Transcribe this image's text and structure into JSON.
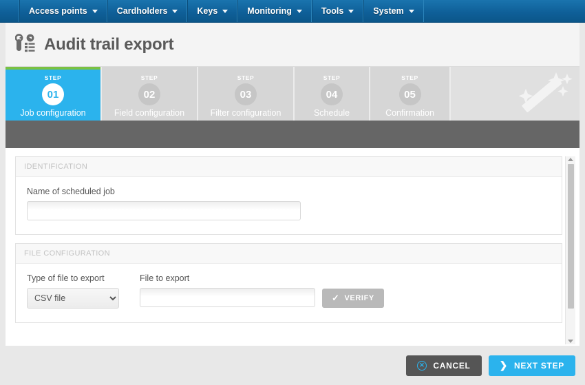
{
  "nav": {
    "items": [
      {
        "label": "Access points",
        "icon": "chevron-down-icon"
      },
      {
        "label": "Cardholders",
        "icon": "chevron-down-icon"
      },
      {
        "label": "Keys",
        "icon": "chevron-down-icon"
      },
      {
        "label": "Monitoring",
        "icon": "chevron-down-icon"
      },
      {
        "label": "Tools",
        "icon": "chevron-down-icon"
      },
      {
        "label": "System",
        "icon": "chevron-down-icon"
      }
    ]
  },
  "header": {
    "title": "Audit trail export",
    "icon": "key-list-export-icon"
  },
  "wizard": {
    "kicker": "STEP",
    "decoration_icon": "magic-wand-icon",
    "steps": [
      {
        "number": "01",
        "label": "Job configuration",
        "active": true
      },
      {
        "number": "02",
        "label": "Field configuration",
        "active": false
      },
      {
        "number": "03",
        "label": "Filter configuration",
        "active": false
      },
      {
        "number": "04",
        "label": "Schedule",
        "active": false
      },
      {
        "number": "05",
        "label": "Confirmation",
        "active": false
      }
    ]
  },
  "identification": {
    "panel_title": "IDENTIFICATION",
    "job_name_label": "Name of scheduled job",
    "job_name_value": "",
    "job_name_placeholder": ""
  },
  "file_configuration": {
    "panel_title": "FILE CONFIGURATION",
    "type_label": "Type of file to export",
    "type_value": "CSV file",
    "type_options": [
      "CSV file"
    ],
    "file_label": "File to export",
    "file_value": "",
    "file_placeholder": "",
    "verify_label": "VERIFY",
    "verify_icon": "check-icon"
  },
  "footer": {
    "cancel_label": "CANCEL",
    "cancel_icon": "circle-x-icon",
    "next_label": "NEXT STEP",
    "next_icon": "chevron-right-icon"
  },
  "scrollbar": {
    "up_icon": "triangle-up-icon",
    "down_icon": "triangle-down-icon"
  },
  "colors": {
    "nav_blue": "#0f6099",
    "accent_blue": "#2bb3ed",
    "accent_green": "#7ac143",
    "toolband_gray": "#666666",
    "step_inactive": "#d6d6d6"
  }
}
